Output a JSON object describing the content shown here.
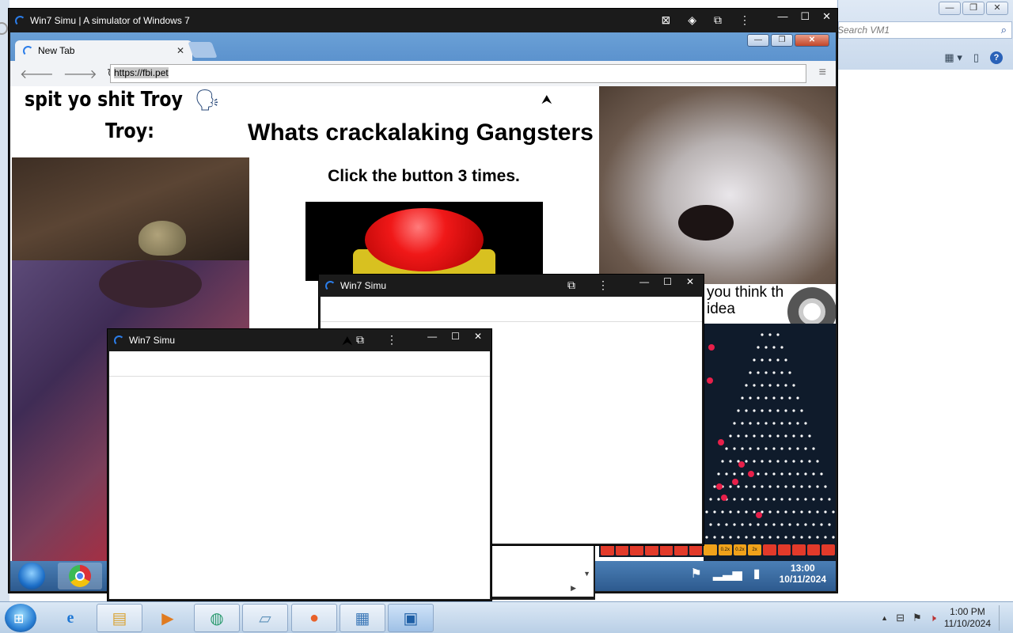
{
  "host": {
    "search_placeholder": "Search VM1",
    "search_icon": "search-icon",
    "controls": [
      "—",
      "❐",
      "✕"
    ]
  },
  "simu": {
    "title": "Win7 Simu | A simulator of Windows 7",
    "controls": [
      "—",
      "☐",
      "✕"
    ]
  },
  "browser": {
    "tab_title": "New Tab",
    "tab_close": "✕",
    "url": "https://fbi.pet",
    "controls": [
      "—",
      "❐",
      "✕"
    ]
  },
  "page": {
    "troy_line1": "spit yo shit Troy",
    "troy_line2": "Troy:",
    "headline": "Whats crackalaking Gangsters",
    "instruction": "Click the button 3 times.",
    "meme_line1": "you think th",
    "meme_line2": "idea",
    "multipliers": [
      "",
      "",
      "",
      "",
      "",
      "",
      "",
      "",
      "0.2x",
      "0.2x",
      "2x",
      "",
      "",
      "",
      "",
      ""
    ]
  },
  "inner_taskbar": {
    "time": "13:00",
    "date": "10/11/2024"
  },
  "popup_a": {
    "title": "Win7 Simu"
  },
  "popup_b": {
    "title": "Win7 Simu"
  },
  "outer_taskbar": {
    "time": "1:00 PM",
    "date": "11/10/2024",
    "tray_arrow": "▲"
  },
  "colors": {
    "simu_bg": "#1b1b1b",
    "spinner": "#2b7de9",
    "red_button": "#f01818"
  }
}
